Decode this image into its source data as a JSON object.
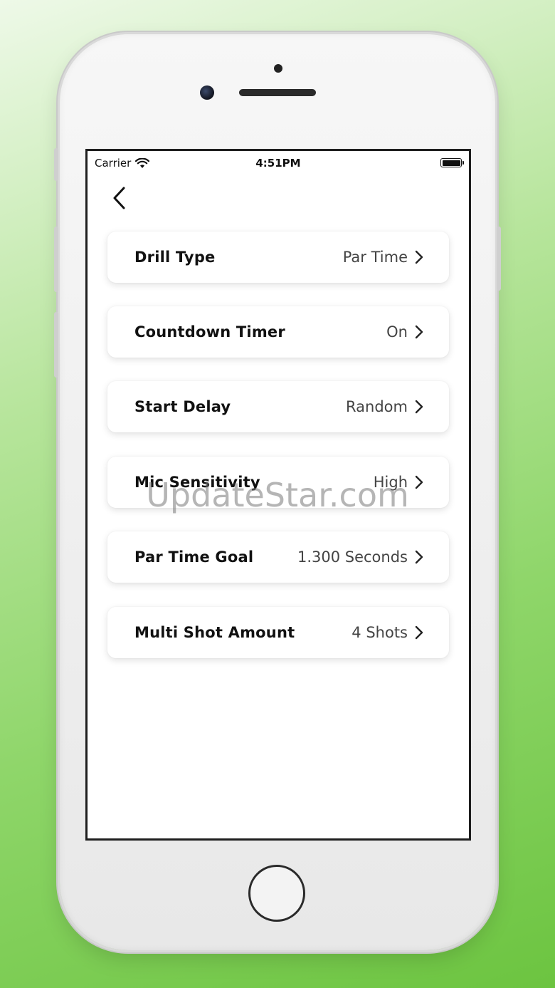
{
  "status_bar": {
    "carrier": "Carrier",
    "time": "4:51PM"
  },
  "icons": {
    "back": "chevron-left-icon",
    "row_arrow": "chevron-right-icon",
    "wifi": "wifi-icon",
    "battery": "battery-icon"
  },
  "settings": [
    {
      "label": "Drill Type",
      "value": "Par Time"
    },
    {
      "label": "Countdown Timer",
      "value": "On"
    },
    {
      "label": "Start Delay",
      "value": "Random"
    },
    {
      "label": "Mic Sensitivity",
      "value": "High"
    },
    {
      "label": "Par Time Goal",
      "value": "1.300 Seconds"
    },
    {
      "label": "Multi Shot Amount",
      "value": "4 Shots"
    }
  ],
  "watermark": "UpdateStar.com"
}
